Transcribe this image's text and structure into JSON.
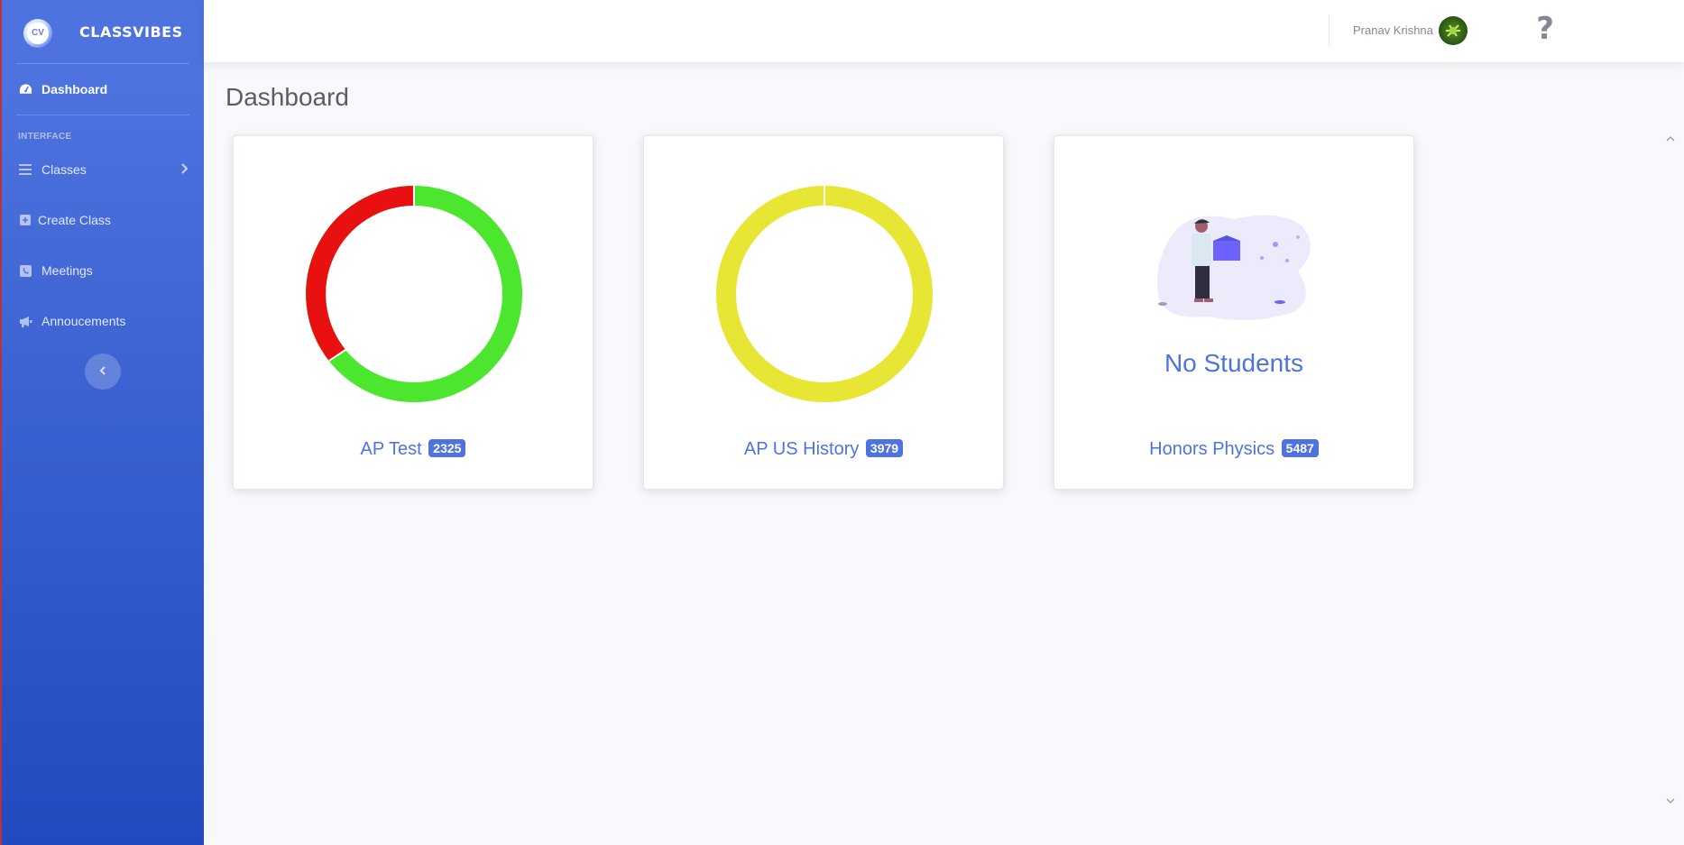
{
  "brand": {
    "logo_text": "CV",
    "name": "CLASSVIBES"
  },
  "sidebar": {
    "dashboard": "Dashboard",
    "heading": "INTERFACE",
    "items": [
      {
        "label": "Classes",
        "icon": "list-icon"
      },
      {
        "label": "Create Class",
        "icon": "plus-square-icon"
      },
      {
        "label": "Meetings",
        "icon": "phone-icon"
      },
      {
        "label": "Annoucements",
        "icon": "megaphone-icon"
      }
    ]
  },
  "topbar": {
    "help": "?",
    "username": "Pranav Krishna"
  },
  "main": {
    "title": "Dashboard"
  },
  "cards": [
    {
      "name": "AP Test",
      "code": "2325",
      "chart": {
        "type": "donut",
        "segments": [
          {
            "color": "#4ce62e",
            "fraction": 0.65
          },
          {
            "color": "#e81010",
            "fraction": 0.35
          }
        ]
      }
    },
    {
      "name": "AP US History",
      "code": "3979",
      "chart": {
        "type": "donut",
        "segments": [
          {
            "color": "#e8e634",
            "fraction": 1.0
          }
        ]
      }
    },
    {
      "name": "Honors Physics",
      "code": "5487",
      "empty_text": "No Students"
    }
  ]
}
